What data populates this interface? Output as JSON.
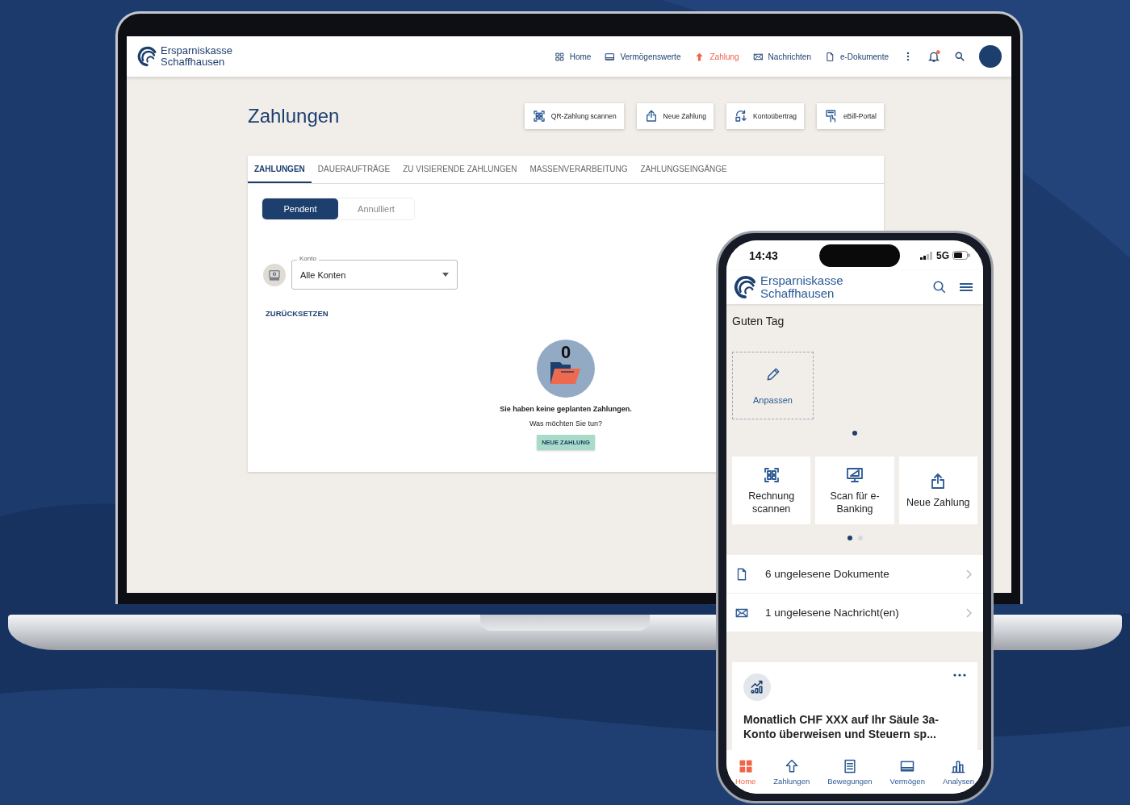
{
  "laptop": {
    "brand": {
      "line1": "Ersparniskasse",
      "line2": "Schaffhausen"
    },
    "nav": [
      {
        "label": "Home",
        "kind": "grid",
        "selected": false
      },
      {
        "label": "Vermögenswerte",
        "kind": "card",
        "selected": false
      },
      {
        "label": "Zahlung",
        "kind": "uparrow",
        "selected": true
      },
      {
        "label": "Nachrichten",
        "kind": "mail",
        "selected": false
      },
      {
        "label": "e-Dokumente",
        "kind": "document",
        "selected": false
      }
    ],
    "bell": {
      "unread": true
    },
    "page_title": "Zahlungen",
    "actions": [
      {
        "label": "QR-Zahlung scannen",
        "kind": "qr"
      },
      {
        "label": "Neue Zahlung",
        "kind": "upload"
      },
      {
        "label": "Kontoübertrag",
        "kind": "transfer"
      },
      {
        "label": "eBill-Portal",
        "kind": "touch"
      }
    ],
    "tabs": [
      {
        "label": "ZAHLUNGEN",
        "selected": true
      },
      {
        "label": "DAUERAUFTRÄGE",
        "selected": false
      },
      {
        "label": "ZU VISIERENDE ZAHLUNGEN",
        "selected": false
      },
      {
        "label": "MASSENVERARBEITUNG",
        "selected": false
      },
      {
        "label": "ZAHLUNGSEINGÄNGE",
        "selected": false
      }
    ],
    "segments": [
      {
        "label": "Pendent",
        "selected": true
      },
      {
        "label": "Annulliert",
        "selected": false
      }
    ],
    "account_field": {
      "label": "Konto",
      "value": "Alle Konten"
    },
    "reset_link": "ZURÜCKSETZEN",
    "empty_state": {
      "count": "0",
      "message": "Sie haben keine geplanten Zahlungen.",
      "question": "Was möchten Sie tun?",
      "button": "NEUE ZAHLUNG"
    }
  },
  "phone": {
    "status": {
      "time": "14:43",
      "network": "5G"
    },
    "brand": {
      "line1": "Ersparniskasse",
      "line2": "Schaffhausen"
    },
    "greeting": "Guten Tag",
    "customize": "Anpassen",
    "pages_top": [
      {
        "selected": true
      }
    ],
    "quick_actions": [
      {
        "label": "Rechnung scannen",
        "kind": "qr"
      },
      {
        "label": "Scan für e-Banking",
        "kind": "monitor"
      },
      {
        "label": "Neue Zahlung",
        "kind": "upload"
      }
    ],
    "pages_actions": [
      {
        "selected": true
      },
      {
        "selected": false
      }
    ],
    "notices": [
      {
        "text": "6 ungelesene Dokumente",
        "kind": "document"
      },
      {
        "text": "1 ungelesene Nachricht(en)",
        "kind": "mail"
      }
    ],
    "suggestion": {
      "title": "Monatlich CHF XXX auf Ihr Säule 3a-Konto überweisen und Steuern sp..."
    },
    "tabbar": [
      {
        "label": "Home",
        "kind": "gridfill",
        "selected": true
      },
      {
        "label": "Zahlungen",
        "kind": "uparrowline",
        "selected": false
      },
      {
        "label": "Bewegungen",
        "kind": "list",
        "selected": false
      },
      {
        "label": "Vermögen",
        "kind": "card",
        "selected": false
      },
      {
        "label": "Analysen",
        "kind": "bars",
        "selected": false
      }
    ]
  }
}
